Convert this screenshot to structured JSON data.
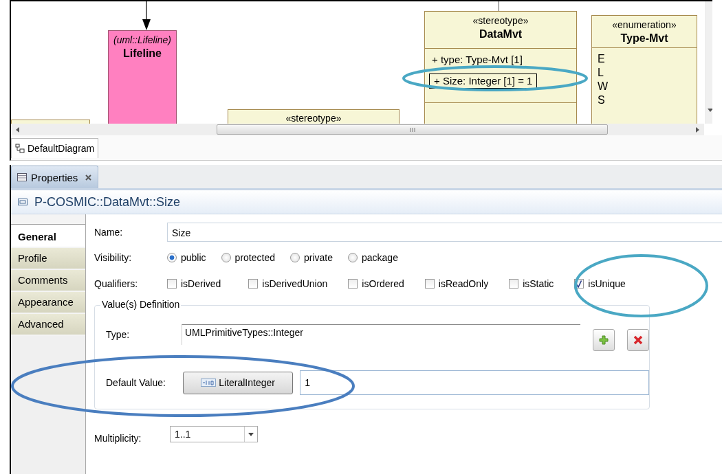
{
  "diagram": {
    "nodes": [
      {
        "kind": "lifeline",
        "stereotype": "(uml::Lifeline)",
        "name": "Lifeline"
      },
      {
        "kind": "class",
        "stereotype": "«stereotype»",
        "name": "DataMvt",
        "attributes": [
          {
            "text": "+ type: Type-Mvt [1]",
            "selected": false
          },
          {
            "text": "+ Size: Integer [1] = 1",
            "selected": true
          }
        ]
      },
      {
        "kind": "enum",
        "stereotype": "«enumeration»",
        "name": "Type-Mvt",
        "literals": [
          "E",
          "L",
          "W",
          "S"
        ]
      },
      {
        "kind": "stub",
        "stereotype": "«stereotype»"
      },
      {
        "kind": "blank"
      }
    ]
  },
  "diagram_tab": {
    "label": "DefaultDiagram",
    "selected": true
  },
  "view_tab": {
    "label": "Properties",
    "selected": true
  },
  "title": "P-COSMIC::DataMvt::Size",
  "sections": [
    {
      "label": "General",
      "selected": true
    },
    {
      "label": "Profile",
      "selected": false
    },
    {
      "label": "Comments",
      "selected": false
    },
    {
      "label": "Appearance",
      "selected": false
    },
    {
      "label": "Advanced",
      "selected": false
    }
  ],
  "name_field": {
    "label": "Name:",
    "value": "Size"
  },
  "visibility": {
    "label": "Visibility:",
    "options": [
      {
        "label": "public",
        "selected": true
      },
      {
        "label": "protected",
        "selected": false
      },
      {
        "label": "private",
        "selected": false
      },
      {
        "label": "package",
        "selected": false
      }
    ]
  },
  "qualifiers": {
    "label": "Qualifiers:",
    "options": [
      {
        "label": "isDerived",
        "checked": false
      },
      {
        "label": "isDerivedUnion",
        "checked": false
      },
      {
        "label": "isOrdered",
        "checked": false
      },
      {
        "label": "isReadOnly",
        "checked": false
      },
      {
        "label": "isStatic",
        "checked": false
      },
      {
        "label": "isUnique",
        "checked": true
      }
    ]
  },
  "value_definition": {
    "legend": "Value(s) Definition",
    "type": {
      "label": "Type:",
      "value": "UMLPrimitiveTypes::Integer"
    },
    "default_value": {
      "label": "Default Value:",
      "button": "LiteralInteger",
      "value": "1"
    }
  },
  "multiplicity": {
    "label": "Multiplicity:",
    "value": "1..1"
  },
  "annotations": [
    {
      "kind": "ellipse",
      "color": "#4aa8c4"
    },
    {
      "kind": "ellipse",
      "color": "#4aa8c4"
    },
    {
      "kind": "ellipse",
      "color": "#4a7ebf"
    }
  ]
}
